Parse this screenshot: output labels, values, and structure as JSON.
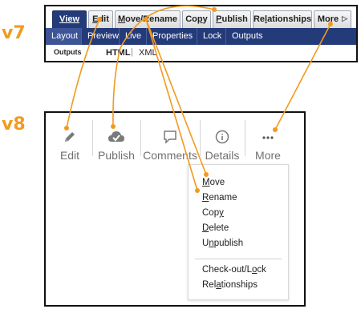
{
  "labels": {
    "v7": "v7",
    "v8": "v8"
  },
  "v7": {
    "tabs": [
      {
        "pre": "",
        "u": "V",
        "post": "iew"
      },
      {
        "pre": "",
        "u": "E",
        "post": "dit"
      },
      {
        "pre": "",
        "u": "M",
        "post": "ove/Rename"
      },
      {
        "pre": "Co",
        "u": "p",
        "post": "y"
      },
      {
        "pre": "",
        "u": "P",
        "post": "ublish"
      },
      {
        "pre": "Re",
        "u": "l",
        "post": "ationships"
      },
      {
        "pre": "More",
        "u": "",
        "post": ""
      }
    ],
    "more_arrow": "▷",
    "subtabs": [
      "Layout",
      "Preview",
      "Live",
      "Properties",
      "Lock",
      "Outputs"
    ],
    "outputs_label": "Outputs",
    "output_html": "HTML",
    "output_sep": "|",
    "output_xml": "XML"
  },
  "v8": {
    "tools": [
      {
        "label": "Edit",
        "icon": "pencil-icon"
      },
      {
        "label": "Publish",
        "icon": "cloud-check-icon"
      },
      {
        "label": "Comments",
        "icon": "comment-icon"
      },
      {
        "label": "Details",
        "icon": "info-icon"
      },
      {
        "label": "More",
        "icon": "more-dots-icon"
      }
    ],
    "menu": [
      {
        "pre": "",
        "u": "M",
        "post": "ove"
      },
      {
        "pre": "",
        "u": "R",
        "post": "ename"
      },
      {
        "pre": "Cop",
        "u": "y",
        "post": ""
      },
      {
        "pre": "",
        "u": "D",
        "post": "elete"
      },
      {
        "pre": "U",
        "u": "n",
        "post": "publish"
      },
      {
        "pre": "Check-out/L",
        "u": "o",
        "post": "ck"
      },
      {
        "pre": "Rel",
        "u": "a",
        "post": "tionships"
      }
    ]
  },
  "colors": {
    "accent": "#f39a1e",
    "ribbon_blue": "#243b7a"
  }
}
